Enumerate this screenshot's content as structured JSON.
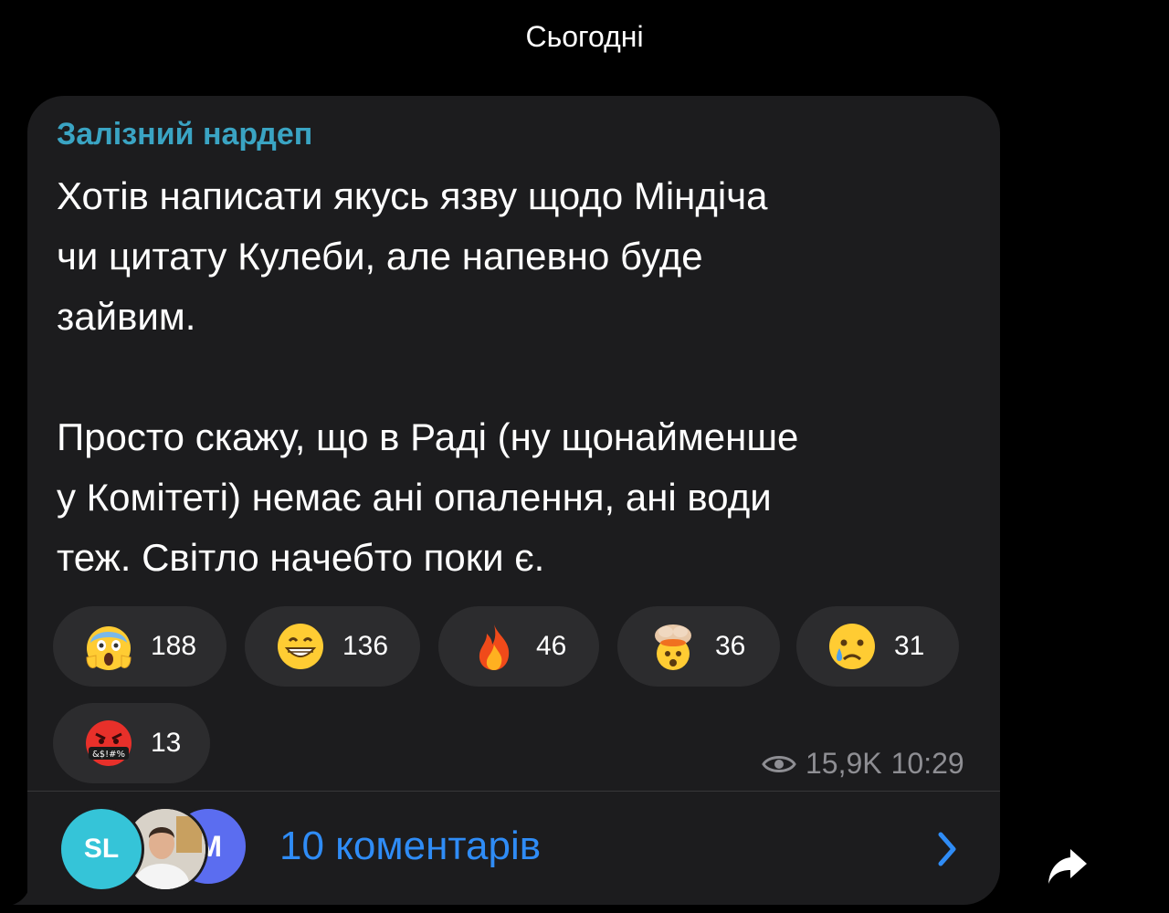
{
  "date_header": "Сьогодні",
  "message": {
    "author": "Залізний нардеп",
    "paragraph1_lines": [
      "Хотів написати якусь язву щодо Міндіча",
      "чи цитату Кулеби, але напевно буде",
      "зайвим."
    ],
    "paragraph2_lines": [
      "Просто скажу, що в Раді (ну щонайменше",
      "у Комітеті) немає ані опалення, ані води",
      "теж. Світло начебто поки є."
    ],
    "reactions": [
      {
        "icon": "screaming-face-icon",
        "count": "188"
      },
      {
        "icon": "grinning-face-icon",
        "count": "136"
      },
      {
        "icon": "fire-icon",
        "count": "46"
      },
      {
        "icon": "exploding-head-icon",
        "count": "36"
      },
      {
        "icon": "crying-face-icon",
        "count": "31"
      },
      {
        "icon": "cursing-face-icon",
        "count": "13"
      }
    ],
    "views": "15,9K",
    "time": "10:29"
  },
  "comments": {
    "avatars": [
      "SL",
      "",
      "M"
    ],
    "label": "10 коментарів"
  },
  "colors": {
    "background": "#000000",
    "bubble": "#1c1c1e",
    "pill": "#2c2c2e",
    "author": "#3aa4c3",
    "link": "#2f8cf6",
    "meta": "#8e8e93"
  }
}
